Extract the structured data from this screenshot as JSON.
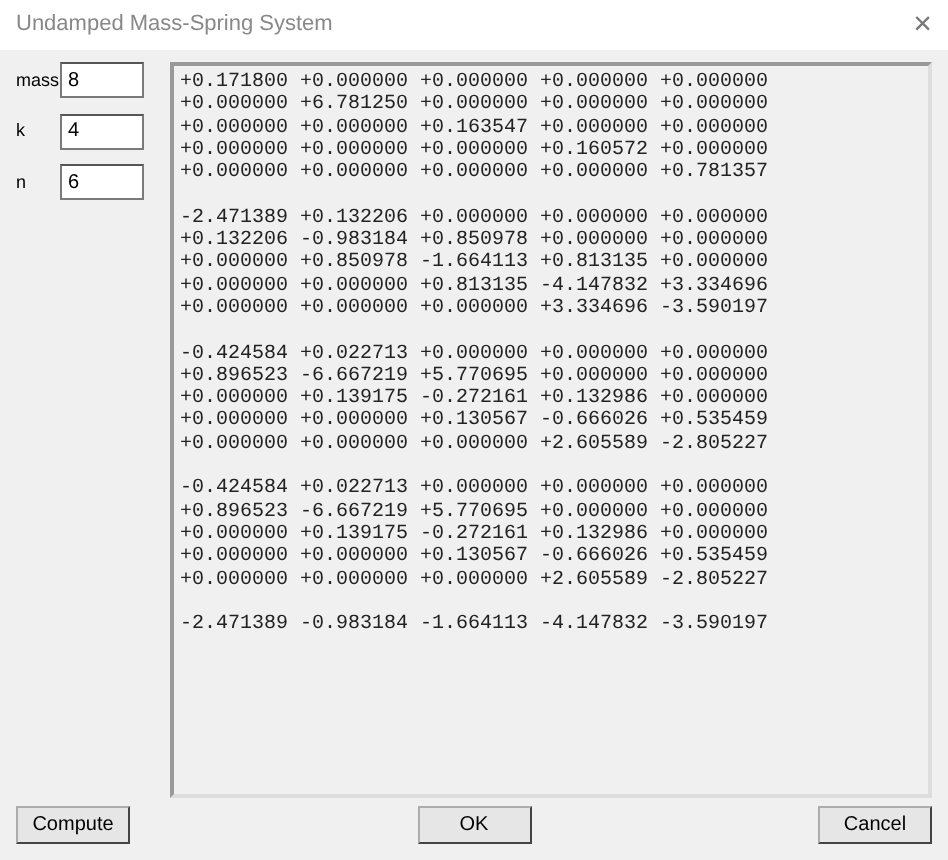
{
  "window": {
    "title": "Undamped Mass-Spring System",
    "close": "×"
  },
  "fields": [
    {
      "label": "mass",
      "value": "8"
    },
    {
      "label": "k",
      "value": "4"
    },
    {
      "label": "n",
      "value": "6"
    }
  ],
  "output": {
    "blocks": [
      [
        "+0.171800 +0.000000 +0.000000 +0.000000 +0.000000",
        "+0.000000 +6.781250 +0.000000 +0.000000 +0.000000",
        "+0.000000 +0.000000 +0.163547 +0.000000 +0.000000",
        "+0.000000 +0.000000 +0.000000 +0.160572 +0.000000",
        "+0.000000 +0.000000 +0.000000 +0.000000 +0.781357"
      ],
      [
        "-2.471389 +0.132206 +0.000000 +0.000000 +0.000000",
        "+0.132206 -0.983184 +0.850978 +0.000000 +0.000000",
        "+0.000000 +0.850978 -1.664113 +0.813135 +0.000000",
        "+0.000000 +0.000000 +0.813135 -4.147832 +3.334696",
        "+0.000000 +0.000000 +0.000000 +3.334696 -3.590197"
      ],
      [
        "-0.424584 +0.022713 +0.000000 +0.000000 +0.000000",
        "+0.896523 -6.667219 +5.770695 +0.000000 +0.000000",
        "+0.000000 +0.139175 -0.272161 +0.132986 +0.000000",
        "+0.000000 +0.000000 +0.130567 -0.666026 +0.535459",
        "+0.000000 +0.000000 +0.000000 +2.605589 -2.805227"
      ],
      [
        "-0.424584 +0.022713 +0.000000 +0.000000 +0.000000",
        "+0.896523 -6.667219 +5.770695 +0.000000 +0.000000",
        "+0.000000 +0.139175 -0.272161 +0.132986 +0.000000",
        "+0.000000 +0.000000 +0.130567 -0.666026 +0.535459",
        "+0.000000 +0.000000 +0.000000 +2.605589 -2.805227"
      ],
      [
        "-2.471389 -0.983184 -1.664113 -4.147832 -3.590197"
      ]
    ]
  },
  "buttons": [
    {
      "label": "Compute"
    },
    {
      "label": "OK"
    },
    {
      "label": "Cancel"
    }
  ]
}
